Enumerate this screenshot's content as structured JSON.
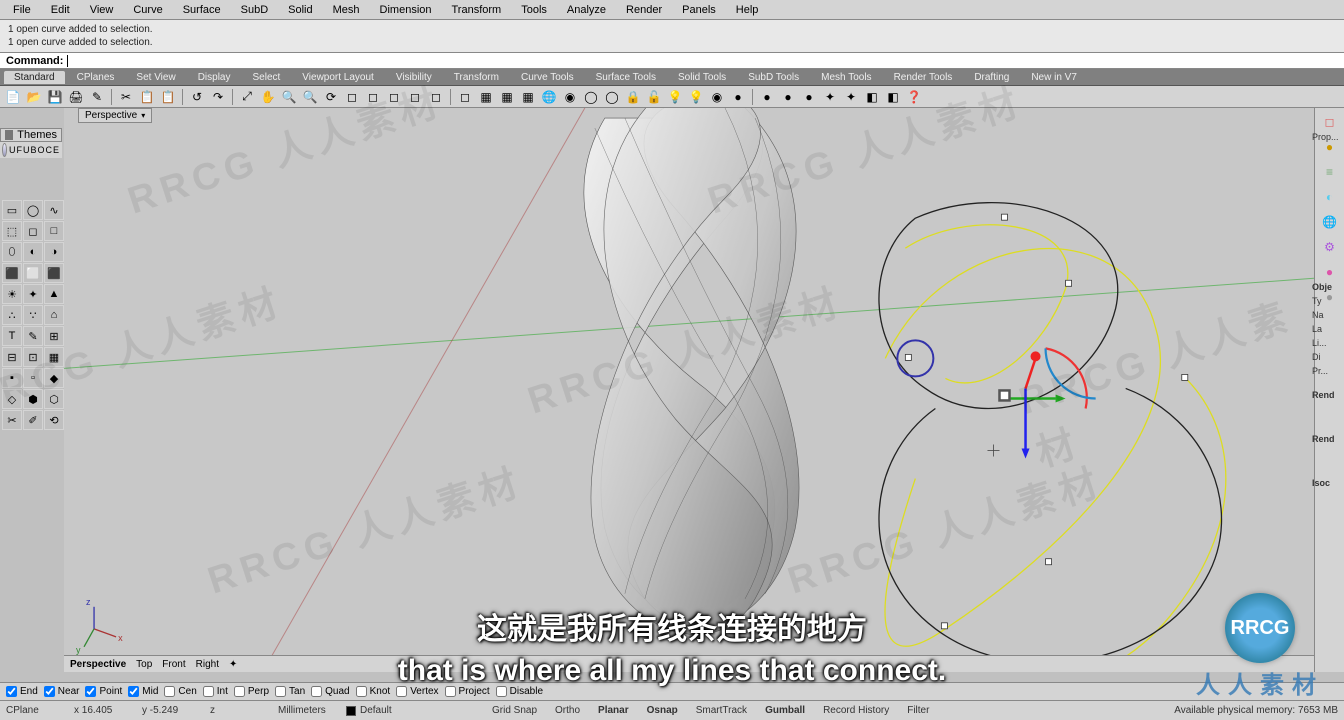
{
  "menu": [
    "File",
    "Edit",
    "View",
    "Curve",
    "Surface",
    "SubD",
    "Solid",
    "Mesh",
    "Dimension",
    "Transform",
    "Tools",
    "Analyze",
    "Render",
    "Panels",
    "Help"
  ],
  "cmdhist": [
    "1 open curve added to selection.",
    "1 open curve added to selection."
  ],
  "cmdprompt": "Command:",
  "tabs": [
    "Standard",
    "CPlanes",
    "Set View",
    "Display",
    "Select",
    "Viewport Layout",
    "Visibility",
    "Transform",
    "Curve Tools",
    "Surface Tools",
    "Solid Tools",
    "SubD Tools",
    "Mesh Tools",
    "Render Tools",
    "Drafting",
    "New in V7"
  ],
  "toolbar_icons": [
    "📄",
    "📂",
    "💾",
    "🖨",
    "✎",
    "✂",
    "📋",
    "📋",
    "↺",
    "↷",
    "⤢",
    "✋",
    "🔍",
    "🔍",
    "⟳",
    "◻",
    "◻",
    "◻",
    "◻",
    "◻",
    "◻",
    "▦",
    "▦",
    "▦",
    "🌐",
    "◉",
    "◯",
    "◯",
    "🔒",
    "🔓",
    "💡",
    "💡",
    "◉",
    "●",
    "●",
    "●",
    "●",
    "✦",
    "✦",
    "◧",
    "◧",
    "❓"
  ],
  "left_palette_title": "Themes",
  "theme_name": "UFUBOCE",
  "vp_title": "Perspective",
  "vp_tabs": [
    "Perspective",
    "Top",
    "Front",
    "Right",
    "✦"
  ],
  "right_panels": [
    "◻",
    "●",
    "≡",
    "◐",
    "🌐",
    "⚙",
    "●",
    "●"
  ],
  "right_labels": [
    "Prop...",
    "Obje",
    "Ty",
    "Na",
    "La",
    "Li...",
    "Di",
    "Pr...",
    "Rend",
    "Rend",
    "Isoc"
  ],
  "osnap": [
    {
      "l": "End",
      "c": true
    },
    {
      "l": "Near",
      "c": true
    },
    {
      "l": "Point",
      "c": true
    },
    {
      "l": "Mid",
      "c": true
    },
    {
      "l": "Cen",
      "c": false
    },
    {
      "l": "Int",
      "c": false
    },
    {
      "l": "Perp",
      "c": false
    },
    {
      "l": "Tan",
      "c": false
    },
    {
      "l": "Quad",
      "c": false
    },
    {
      "l": "Knot",
      "c": false
    },
    {
      "l": "Vertex",
      "c": false
    },
    {
      "l": "Project",
      "c": false
    },
    {
      "l": "Disable",
      "c": false
    }
  ],
  "status": {
    "cplane": "CPlane",
    "x": "x 16.405",
    "y": "y -5.249",
    "z": "z",
    "units": "Millimeters",
    "layer": "Default",
    "cells": [
      "Grid Snap",
      "Ortho",
      "Planar",
      "Osnap",
      "SmartTrack",
      "Gumball",
      "Record History",
      "Filter"
    ],
    "mem": "Available physical memory: 7653 MB"
  },
  "subtitle_cn": "这就是我所有线条连接的地方",
  "subtitle_en": "that is where all my lines that connect.",
  "watermark": "RRCG 人人素材",
  "logo_letters": "RRCG",
  "logo_sub": "人人素材"
}
